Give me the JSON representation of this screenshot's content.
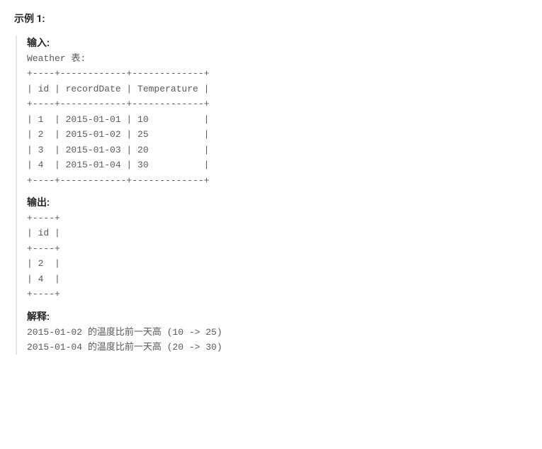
{
  "example": {
    "title": "示例 1:",
    "input_label": "输入:",
    "input_text": "Weather 表:\n+----+------------+-------------+\n| id | recordDate | Temperature |\n+----+------------+-------------+\n| 1  | 2015-01-01 | 10          |\n| 2  | 2015-01-02 | 25          |\n| 3  | 2015-01-03 | 20          |\n| 4  | 2015-01-04 | 30          |\n+----+------------+-------------+",
    "output_label": "输出:",
    "output_text": "+----+\n| id |\n+----+\n| 2  |\n| 4  |\n+----+",
    "explanation_label": "解释:",
    "explanation_text": "2015-01-02 的温度比前一天高 (10 -> 25)\n2015-01-04 的温度比前一天高 (20 -> 30)"
  },
  "chart_data": {
    "type": "table",
    "title": "Weather 表",
    "columns": [
      "id",
      "recordDate",
      "Temperature"
    ],
    "rows": [
      [
        1,
        "2015-01-01",
        10
      ],
      [
        2,
        "2015-01-02",
        25
      ],
      [
        3,
        "2015-01-03",
        20
      ],
      [
        4,
        "2015-01-04",
        30
      ]
    ],
    "output_table": {
      "columns": [
        "id"
      ],
      "rows": [
        [
          2
        ],
        [
          4
        ]
      ]
    }
  }
}
